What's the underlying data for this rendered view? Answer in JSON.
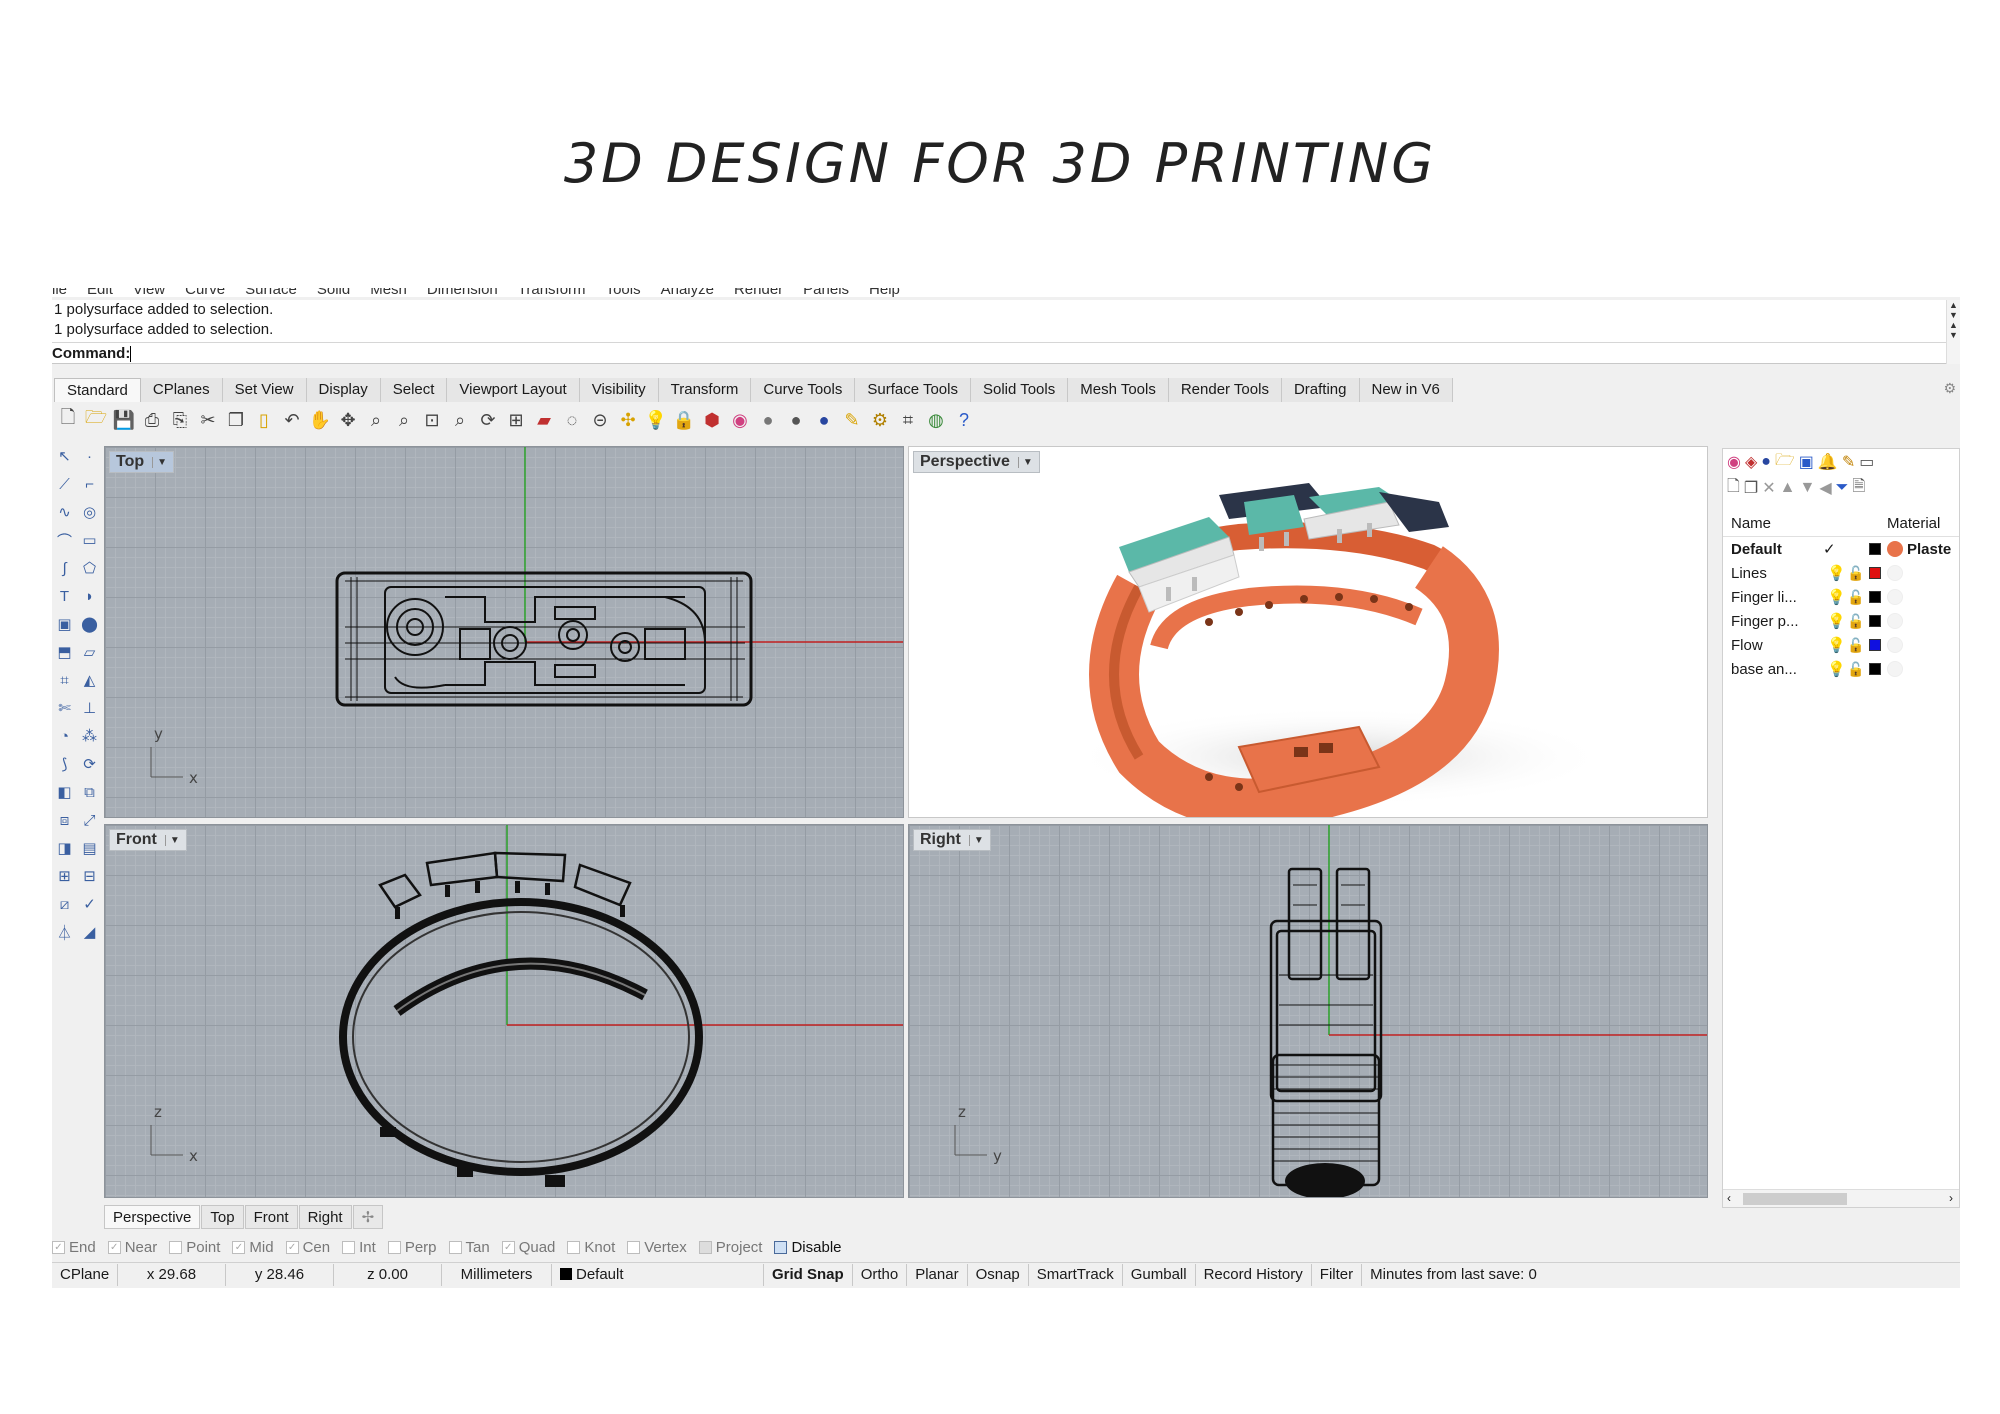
{
  "page": {
    "title": "3D DESIGN FOR 3D PRINTING"
  },
  "menu": [
    "ile",
    "Edit",
    "View",
    "Curve",
    "Surface",
    "Solid",
    "Mesh",
    "Dimension",
    "Transform",
    "Tools",
    "Analyze",
    "Render",
    "Panels",
    "Help"
  ],
  "command": {
    "history": [
      "1 polysurface added to selection.",
      "1 polysurface added to selection."
    ],
    "prompt": "Command:",
    "value": ""
  },
  "tabs": [
    "Standard",
    "CPlanes",
    "Set View",
    "Display",
    "Select",
    "Viewport Layout",
    "Visibility",
    "Transform",
    "Curve Tools",
    "Surface Tools",
    "Solid Tools",
    "Mesh Tools",
    "Render Tools",
    "Drafting",
    "New in V6"
  ],
  "toolbar_icons": [
    "new-icon",
    "open-icon",
    "save-icon",
    "print-icon",
    "import-icon",
    "cut-icon",
    "copy-icon",
    "paste-icon",
    "undo-icon",
    "pan-icon",
    "move-icon",
    "zoom-icon",
    "zoom-window-icon",
    "zoom-extents-icon",
    "zoom-selected-icon",
    "rotate-view-icon",
    "four-view-icon",
    "car-icon",
    "hide-icon",
    "cplane-icon",
    "snap-icon",
    "light-icon",
    "lock-icon",
    "shade-icon",
    "color-wheel-icon",
    "sphere-icon",
    "render-sphere-icon",
    "material-sphere-icon",
    "properties-icon",
    "options-icon",
    "gumball-icon",
    "globe-icon",
    "help-icon"
  ],
  "viewports": {
    "top": {
      "label": "Top",
      "axis_a": "y",
      "axis_b": "x"
    },
    "perspective": {
      "label": "Perspective"
    },
    "front": {
      "label": "Front",
      "axis_a": "z",
      "axis_b": "x"
    },
    "right": {
      "label": "Right",
      "axis_a": "z",
      "axis_b": "y"
    }
  },
  "layers": {
    "header": {
      "name": "Name",
      "material": "Material"
    },
    "rows": [
      {
        "name": "Default",
        "current": "✓",
        "color": "#000000",
        "material_color": "#e8734a",
        "material": "Plaste"
      },
      {
        "name": "Lines",
        "current": "",
        "color": "#e01010",
        "material_color": "#f4f4f4",
        "material": ""
      },
      {
        "name": "Finger li...",
        "current": "",
        "color": "#000000",
        "material_color": "#f4f4f4",
        "material": ""
      },
      {
        "name": "Finger p...",
        "current": "",
        "color": "#000000",
        "material_color": "#f4f4f4",
        "material": ""
      },
      {
        "name": "Flow",
        "current": "",
        "color": "#1010e0",
        "material_color": "#f4f4f4",
        "material": ""
      },
      {
        "name": "base an...",
        "current": "",
        "color": "#000000",
        "material_color": "#f4f4f4",
        "material": ""
      }
    ]
  },
  "viewport_tabs": [
    "Perspective",
    "Top",
    "Front",
    "Right"
  ],
  "osnap": [
    {
      "label": "End",
      "checked": true
    },
    {
      "label": "Near",
      "checked": true
    },
    {
      "label": "Point",
      "checked": false
    },
    {
      "label": "Mid",
      "checked": true
    },
    {
      "label": "Cen",
      "checked": true
    },
    {
      "label": "Int",
      "checked": false
    },
    {
      "label": "Perp",
      "checked": false
    },
    {
      "label": "Tan",
      "checked": false
    },
    {
      "label": "Quad",
      "checked": true
    },
    {
      "label": "Knot",
      "checked": false
    },
    {
      "label": "Vertex",
      "checked": false
    },
    {
      "label": "Project",
      "checked": false
    },
    {
      "label": "Disable",
      "checked": false
    }
  ],
  "status": {
    "cplane": "CPlane",
    "x": "x 29.68",
    "y": "y 28.46",
    "z": "z 0.00",
    "units": "Millimeters",
    "layer": "Default",
    "toggles": [
      "Grid Snap",
      "Ortho",
      "Planar",
      "Osnap",
      "SmartTrack",
      "Gumball",
      "Record History",
      "Filter"
    ],
    "save": "Minutes from last save: 0"
  },
  "colors": {
    "band": "#e8734a",
    "teal": "#5bb8a8",
    "navy": "#2b3448",
    "light": "#e6e6e6",
    "grid": "#a6adb5"
  }
}
